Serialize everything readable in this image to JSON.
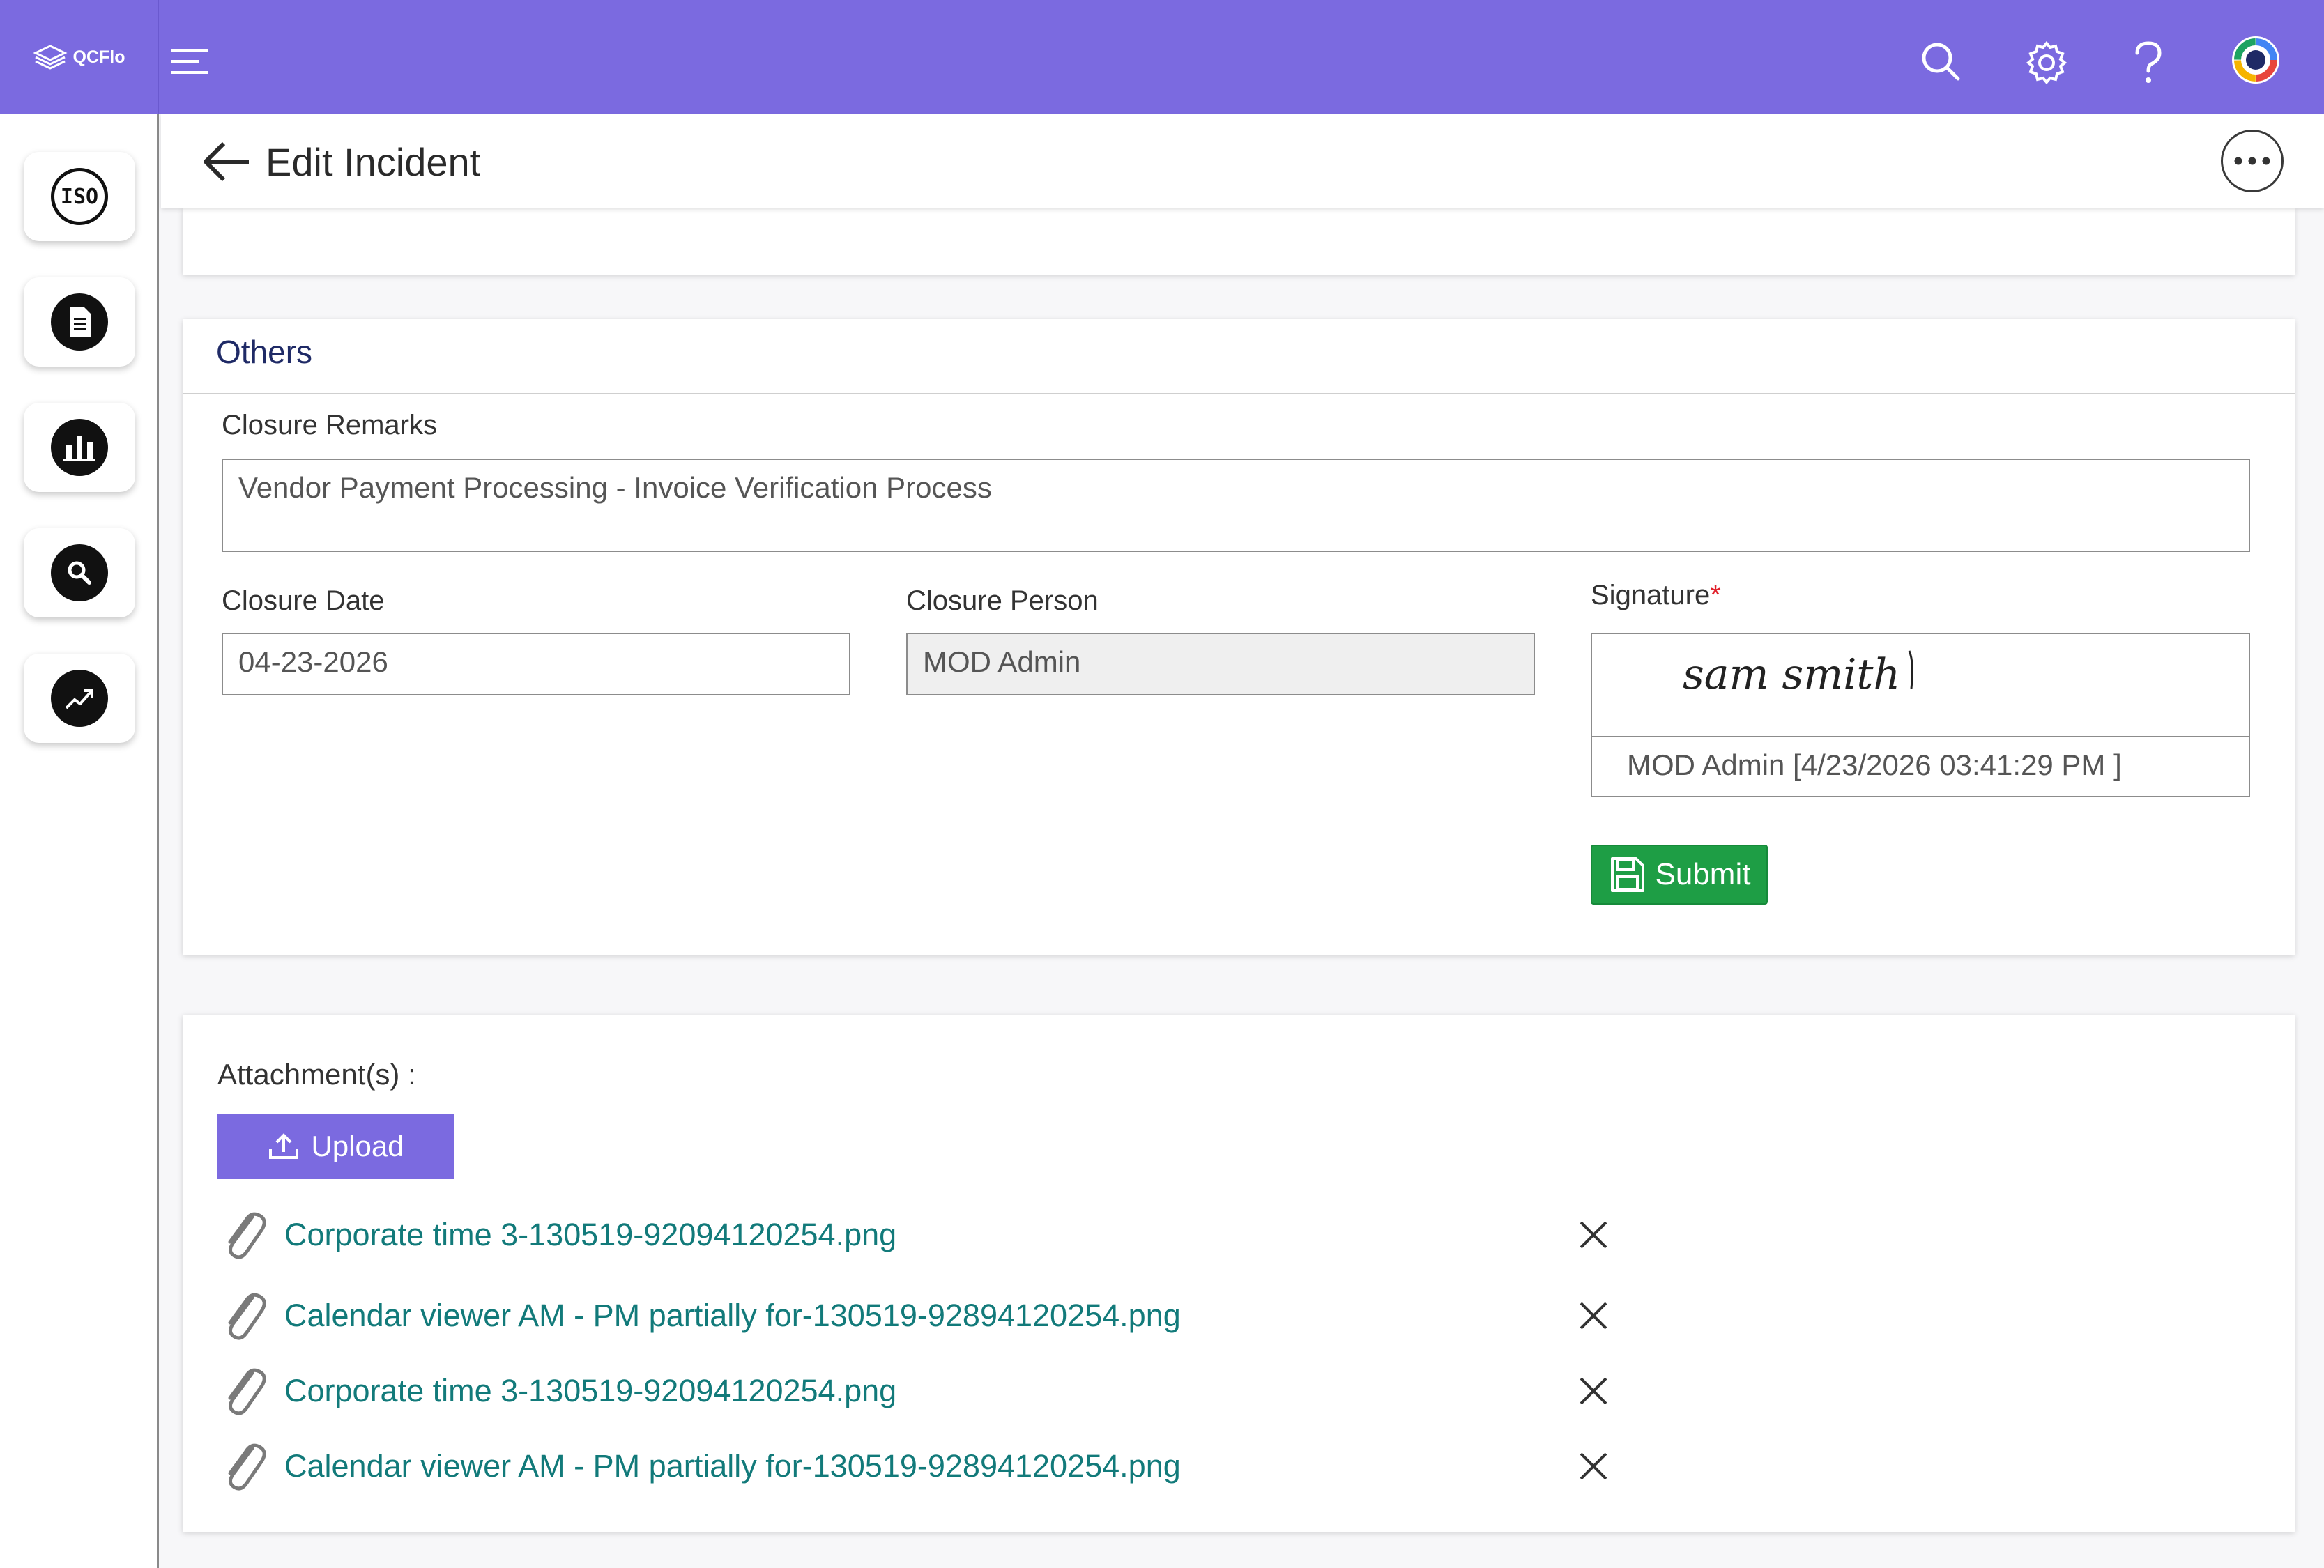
{
  "app": {
    "brand": "QCFlo"
  },
  "header": {
    "title": "Edit Incident"
  },
  "sidebar": {
    "items": [
      {
        "name": "iso-icon",
        "text": "ISO"
      },
      {
        "name": "document-icon"
      },
      {
        "name": "bar-chart-icon"
      },
      {
        "name": "search-icon"
      },
      {
        "name": "trend-icon"
      }
    ]
  },
  "others": {
    "title": "Others",
    "closure_remarks_label": "Closure Remarks",
    "closure_remarks_value": "Vendor Payment Processing - Invoice Verification Process",
    "closure_date_label": "Closure Date",
    "closure_date_value": "04-23-2026",
    "closure_person_label": "Closure Person",
    "closure_person_value": "MOD Admin",
    "signature_label": "Signature",
    "signature_required": "*",
    "signature_text": "sam smith",
    "signature_meta": "MOD Admin [4/23/2026 03:41:29 PM ]",
    "submit_label": "Submit"
  },
  "attachments": {
    "label": "Attachment(s) :",
    "upload_label": "Upload",
    "files": [
      "Corporate time 3-130519-92094120254.png",
      "Calendar viewer AM - PM partially for-130519-92894120254.png",
      "Corporate time 3-130519-92094120254.png",
      "Calendar viewer AM - PM partially for-130519-92894120254.png"
    ]
  },
  "colors": {
    "topbar": "#7b6ae0",
    "submit": "#1e9e45",
    "link": "#127a7a",
    "required": "#e0202a"
  }
}
